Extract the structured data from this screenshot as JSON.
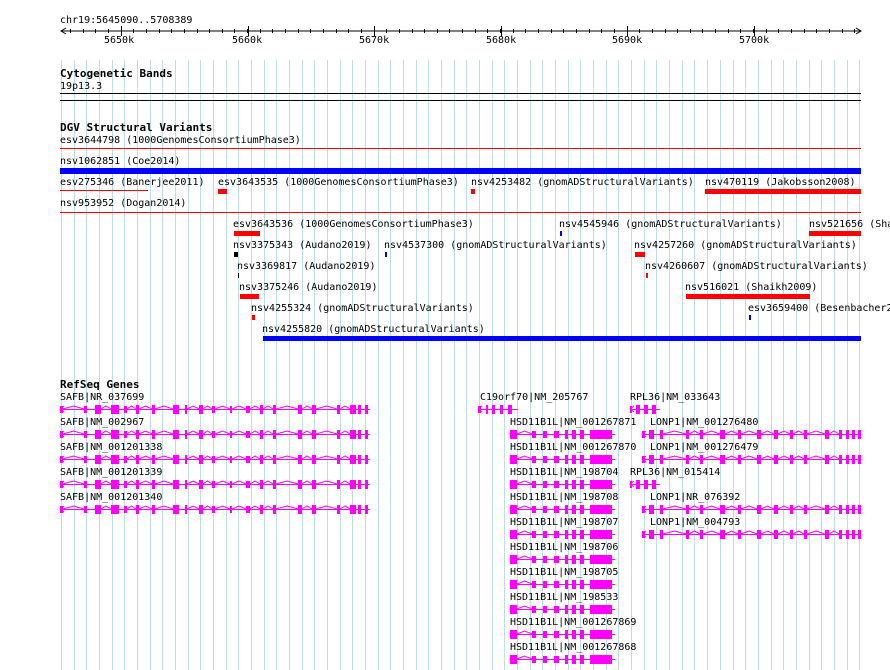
{
  "region": "chr19:5645090..5708389",
  "ruler": {
    "ticks": [
      "5650k",
      "5660k",
      "5670k",
      "5680k",
      "5690k",
      "5700k"
    ]
  },
  "cytoband": {
    "title": "Cytogenetic Bands",
    "band": "19p13.3"
  },
  "dgv": {
    "title": "DGV Structural Variants",
    "features": [
      {
        "id": "esv3644798",
        "label": "esv3644798 (1000GenomesConsortiumPhase3)",
        "color": "#ff0000"
      },
      {
        "id": "nsv1062851",
        "label": "nsv1062851 (Coe2014)",
        "color": "#0000ff"
      },
      {
        "id": "esv275346",
        "label": "esv275346 (Banerjee2011)",
        "color": "#ff0000"
      },
      {
        "id": "esv3643535",
        "label": "esv3643535 (1000GenomesConsortiumPhase3)",
        "color": "#ff0000"
      },
      {
        "id": "nsv4253482",
        "label": "nsv4253482 (gnomADStructuralVariants)",
        "color": "#ff0000"
      },
      {
        "id": "nsv470119",
        "label": "nsv470119 (Jakobsson2008)",
        "color": "#ff0000"
      },
      {
        "id": "nsv953952",
        "label": "nsv953952 (Dogan2014)",
        "color": "#ff0000"
      },
      {
        "id": "esv3643536",
        "label": "esv3643536 (1000GenomesConsortiumPhase3)",
        "color": "#ff0000"
      },
      {
        "id": "nsv4545946",
        "label": "nsv4545946 (gnomADStructuralVariants)",
        "color": "#0000ff"
      },
      {
        "id": "nsv521656",
        "label": "nsv521656 (Sha",
        "color": "#ff0000"
      },
      {
        "id": "nsv3375343",
        "label": "nsv3375343 (Audano2019)",
        "color": "#000000"
      },
      {
        "id": "nsv4537300",
        "label": "nsv4537300 (gnomADStructuralVariants)",
        "color": "#0000ff"
      },
      {
        "id": "nsv4257260",
        "label": "nsv4257260 (gnomADStructuralVariants)",
        "color": "#ff0000"
      },
      {
        "id": "nsv3369817",
        "label": "nsv3369817 (Audano2019)",
        "color": "#000000"
      },
      {
        "id": "nsv4260607",
        "label": "nsv4260607 (gnomADStructuralVariants)",
        "color": "#ff0000"
      },
      {
        "id": "nsv3375246",
        "label": "nsv3375246 (Audano2019)",
        "color": "#ff0000"
      },
      {
        "id": "nsv516021",
        "label": "nsv516021 (Shaikh2009)",
        "color": "#ff0000"
      },
      {
        "id": "nsv4255324",
        "label": "nsv4255324 (gnomADStructuralVariants)",
        "color": "#ff0000"
      },
      {
        "id": "esv3659400",
        "label": "esv3659400 (Besenbacher2",
        "color": "#0000ff"
      },
      {
        "id": "nsv4255820",
        "label": "nsv4255820 (gnomADStructuralVariants)",
        "color": "#0000ff"
      }
    ]
  },
  "refseq": {
    "title": "RefSeq Genes",
    "color": "#ff00ff",
    "genes": [
      "SAFB|NR_037699",
      "SAFB|NM_002967",
      "SAFB|NM_001201338",
      "SAFB|NM_001201339",
      "SAFB|NM_001201340",
      "C19orf70|NM_205767",
      "RPL36|NM_033643",
      "HSD11B1L|NM_001267871",
      "LONP1|NM_001276480",
      "HSD11B1L|NM_001267870",
      "LONP1|NM_001276479",
      "HSD11B1L|NM_198704",
      "RPL36|NM_015414",
      "HSD11B1L|NM_198708",
      "LONP1|NR_076392",
      "HSD11B1L|NM_198707",
      "LONP1|NM_004793",
      "HSD11B1L|NM_198706",
      "HSD11B1L|NM_198705",
      "HSD11B1L|NM_198533",
      "HSD11B1L|NM_001267869",
      "HSD11B1L|NM_001267868"
    ]
  }
}
